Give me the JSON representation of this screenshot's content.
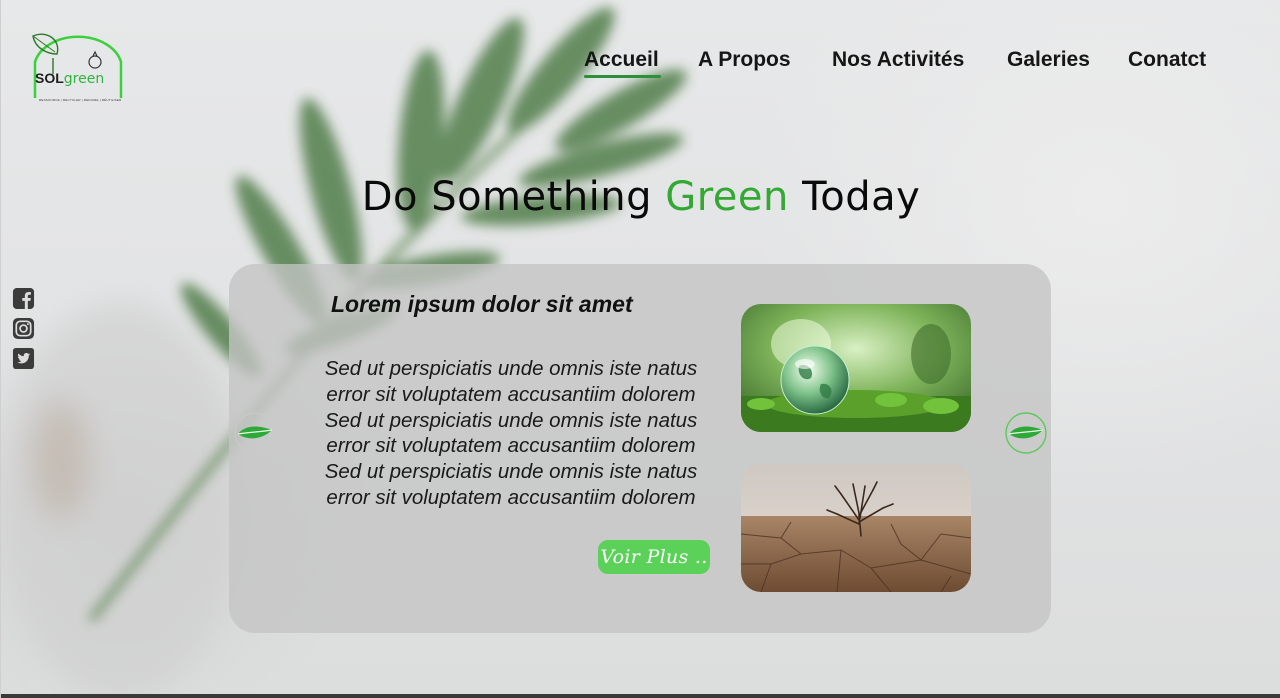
{
  "brand": {
    "name_prefix": "SOL",
    "name_suffix": "green",
    "tagline": "RESSOURCE | RECYCLER | REDUIRE | RÉUTILISER",
    "accent_color": "#33a833"
  },
  "nav": {
    "items": [
      {
        "label": "Accueil",
        "active": true
      },
      {
        "label": "A Propos",
        "active": false
      },
      {
        "label": "Nos Activités",
        "active": false
      },
      {
        "label": "Galeries",
        "active": false
      },
      {
        "label": "Conatct",
        "active": false
      }
    ]
  },
  "hero": {
    "title_part1": "Do Something ",
    "title_highlight": "Green",
    "title_part2": " Today"
  },
  "social": [
    {
      "icon": "facebook-icon"
    },
    {
      "icon": "instagram-icon"
    },
    {
      "icon": "twitter-icon"
    }
  ],
  "card": {
    "heading": "Lorem ipsum dolor sit amet",
    "body": "Sed ut perspiciatis unde omnis iste natus\nerror sit voluptatem accusantiim dolorem\nSed ut perspiciatis unde omnis iste natus\nerror sit voluptatem accusantiim dolorem\nSed ut perspiciatis unde omnis iste natus\nerror sit voluptatem accusantiim dolorem",
    "button_label": "Voir Plus ..",
    "images": [
      {
        "subject": "glass-globe-on-moss"
      },
      {
        "subject": "dead-tree-on-cracked-earth"
      }
    ],
    "prev_icon": "leaf-left-arrow-icon",
    "next_icon": "leaf-right-arrow-icon"
  },
  "colors": {
    "button": "#5bd15a",
    "active_underline": "#2e8f3a",
    "card_bg": "#c4c4c4"
  }
}
